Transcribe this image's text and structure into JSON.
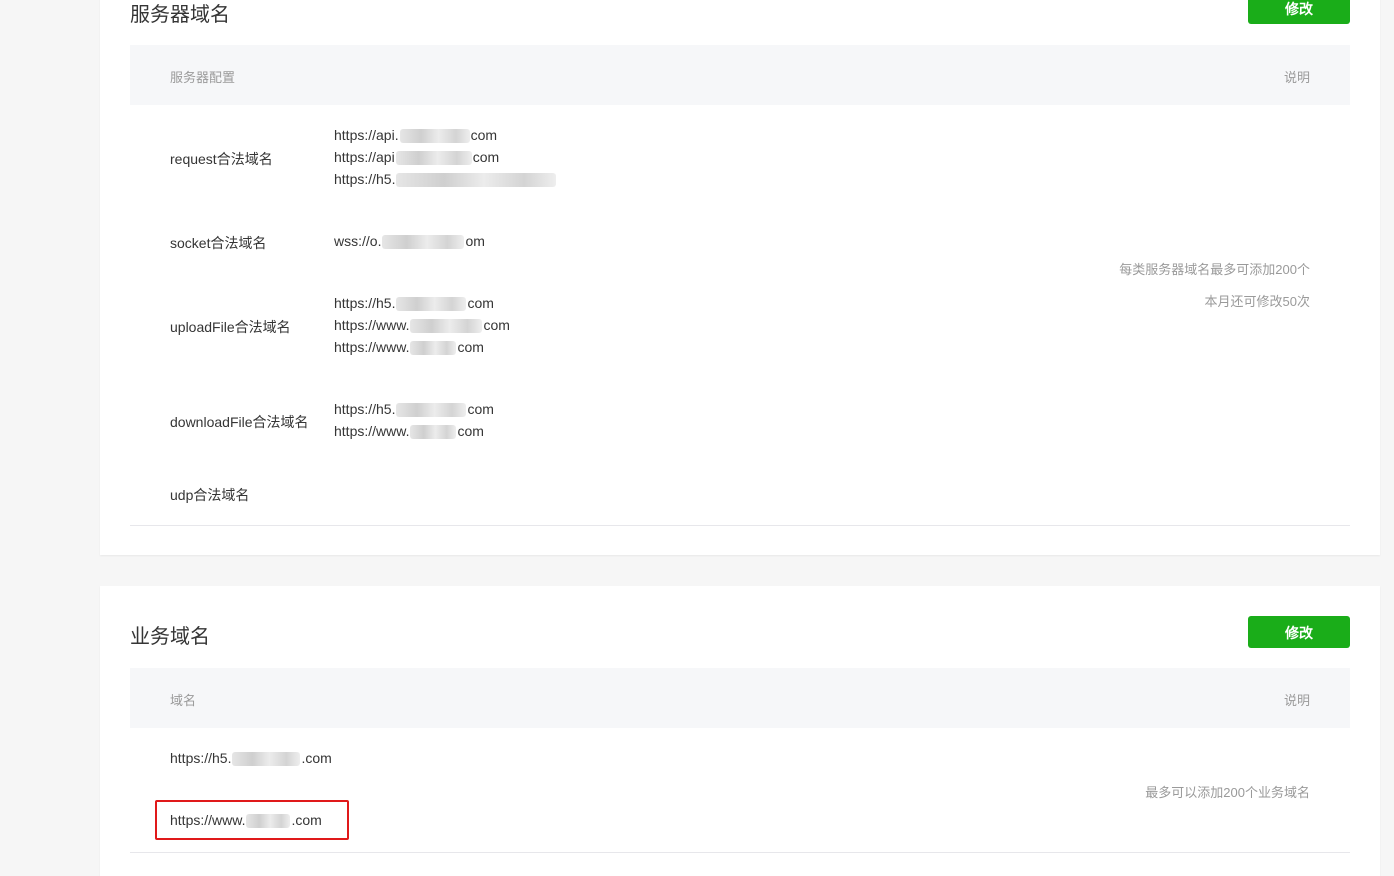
{
  "server_domains": {
    "title": "服务器域名",
    "edit_label": "修改",
    "header_config": "服务器配置",
    "header_desc": "说明",
    "rows": [
      {
        "label": "request合法域名",
        "domains": [
          {
            "pre": "https://api.",
            "post": "com"
          },
          {
            "pre": "https://api",
            "post": "com"
          },
          {
            "pre": "https://h5.",
            "post": ""
          }
        ]
      },
      {
        "label": "socket合法域名",
        "domains": [
          {
            "pre": "wss://o.",
            "post": "om"
          }
        ]
      },
      {
        "label": "uploadFile合法域名",
        "domains": [
          {
            "pre": "https://h5.",
            "post": "com"
          },
          {
            "pre": "https://www.",
            "post": "com"
          },
          {
            "pre": "https://www.",
            "post": "com"
          }
        ]
      },
      {
        "label": "downloadFile合法域名",
        "domains": [
          {
            "pre": "https://h5.",
            "post": "com"
          },
          {
            "pre": "https://www.",
            "post": "com"
          }
        ]
      },
      {
        "label": "udp合法域名",
        "domains": []
      }
    ],
    "note_line1": "每类服务器域名最多可添加200个",
    "note_line2": "本月还可修改50次"
  },
  "business_domains": {
    "title": "业务域名",
    "edit_label": "修改",
    "header_domain": "域名",
    "header_desc": "说明",
    "domains": [
      {
        "pre": "https://h5.",
        "post": ".com"
      },
      {
        "pre": "https://www.",
        "post": ".com"
      }
    ],
    "note": "最多可以添加200个业务域名"
  },
  "colors": {
    "accent": "#1aad19",
    "highlight": "#e0191a",
    "header_bg": "#f6f7f9",
    "page_bg": "#f6f6f6"
  }
}
